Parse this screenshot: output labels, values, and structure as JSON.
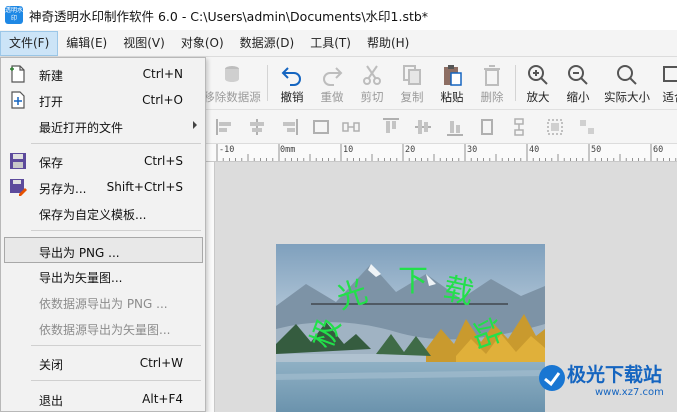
{
  "window": {
    "title": "神奇透明水印制作软件 6.0 - C:\\Users\\admin\\Documents\\水印1.stb*",
    "icon_text": "透明水印"
  },
  "menubar": [
    {
      "label": "文件(F)",
      "active": true
    },
    {
      "label": "编辑(E)"
    },
    {
      "label": "视图(V)"
    },
    {
      "label": "对象(O)"
    },
    {
      "label": "数据源(D)"
    },
    {
      "label": "工具(T)"
    },
    {
      "label": "帮助(H)"
    }
  ],
  "toolbar": {
    "remove_datasource": "移除数据源",
    "undo": "撤销",
    "redo": "重做",
    "cut": "剪切",
    "copy": "复制",
    "paste": "粘贴",
    "delete": "删除",
    "zoom_in": "放大",
    "zoom_out": "缩小",
    "actual_size": "实际大小",
    "fit": "适合"
  },
  "ruler": {
    "unit": "mm",
    "labels": [
      "-10",
      "0mm",
      "10",
      "20",
      "30",
      "40",
      "50",
      "60"
    ]
  },
  "file_menu": {
    "new": {
      "label": "新建",
      "shortcut": "Ctrl+N"
    },
    "open": {
      "label": "打开",
      "shortcut": "Ctrl+O"
    },
    "recent": {
      "label": "最近打开的文件"
    },
    "save": {
      "label": "保存",
      "shortcut": "Ctrl+S"
    },
    "save_as": {
      "label": "另存为...",
      "shortcut": "Shift+Ctrl+S"
    },
    "save_template": {
      "label": "保存为自定义模板..."
    },
    "export_png": {
      "label": "导出为 PNG ..."
    },
    "export_vector": {
      "label": "导出为矢量图..."
    },
    "export_png_ds": {
      "label": "依数据源导出为 PNG ..."
    },
    "export_vector_ds": {
      "label": "依数据源导出为矢量图..."
    },
    "close": {
      "label": "关闭",
      "shortcut": "Ctrl+W"
    },
    "exit": {
      "label": "退出",
      "shortcut": "Alt+F4"
    }
  },
  "canvas": {
    "watermark_text_top": [
      "光",
      "下",
      "载"
    ],
    "watermark_text_vertical": [
      "极",
      "站"
    ]
  },
  "brand_watermark": {
    "name": "极光下载站",
    "url": "www.xz7.com"
  },
  "colors": {
    "accent": "#1e88e5",
    "watermark_green": "#22e04a",
    "menu_active": "#cce4f7"
  }
}
